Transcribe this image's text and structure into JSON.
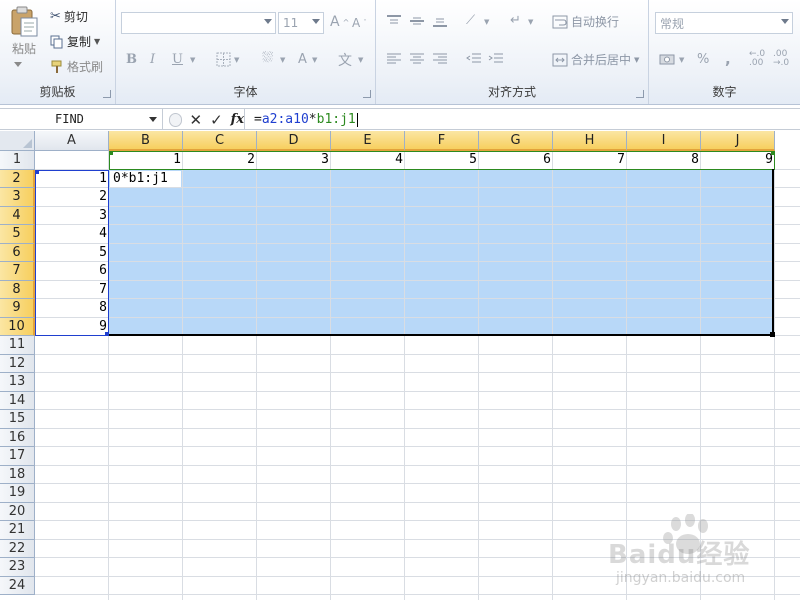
{
  "ribbon": {
    "clipboard": {
      "paste_label": "粘贴",
      "cut_label": "剪切",
      "copy_label": "复制",
      "format_painter_label": "格式刷",
      "group_title": "剪贴板"
    },
    "font": {
      "font_name_value": "",
      "font_size_value": "11",
      "group_title": "字体"
    },
    "alignment": {
      "wrap_text_label": "自动换行",
      "merge_center_label": "合并后居中",
      "group_title": "对齐方式"
    },
    "number": {
      "format_value": "常规",
      "group_title": "数字"
    }
  },
  "formula_bar": {
    "name_box": "FIND",
    "fx_label": "fx",
    "formula": [
      {
        "text": "=",
        "color": "default"
      },
      {
        "text": "a2:a10",
        "color": "blue"
      },
      {
        "text": "*",
        "color": "default"
      },
      {
        "text": "b1:j1",
        "color": "green"
      }
    ]
  },
  "sheet": {
    "columns": [
      "A",
      "B",
      "C",
      "D",
      "E",
      "F",
      "G",
      "H",
      "I",
      "J"
    ],
    "rows": [
      "1",
      "2",
      "3",
      "4",
      "5",
      "6",
      "7",
      "8",
      "9",
      "10",
      "11",
      "12",
      "13",
      "14",
      "15",
      "16",
      "17",
      "18",
      "19",
      "20",
      "21",
      "22",
      "23",
      "24"
    ],
    "selected_columns": [
      "B",
      "C",
      "D",
      "E",
      "F",
      "G",
      "H",
      "I",
      "J"
    ],
    "selected_rows": [
      "2",
      "3",
      "4",
      "5",
      "6",
      "7",
      "8",
      "9",
      "10"
    ],
    "row1_values": [
      "1",
      "2",
      "3",
      "4",
      "5",
      "6",
      "7",
      "8",
      "9"
    ],
    "colA_values": [
      "1",
      "2",
      "3",
      "4",
      "5",
      "6",
      "7",
      "8",
      "9"
    ],
    "active_cell_text": "0*b1:j1",
    "colors": {
      "selection_fill": "#b8d8f8",
      "ref_blue": "#1f3fcf",
      "ref_green": "#2c8a1f",
      "header_selected": "#f7cf5f"
    }
  },
  "watermark": {
    "brand": "Baidu经验",
    "url": "jingyan.baidu.com"
  }
}
